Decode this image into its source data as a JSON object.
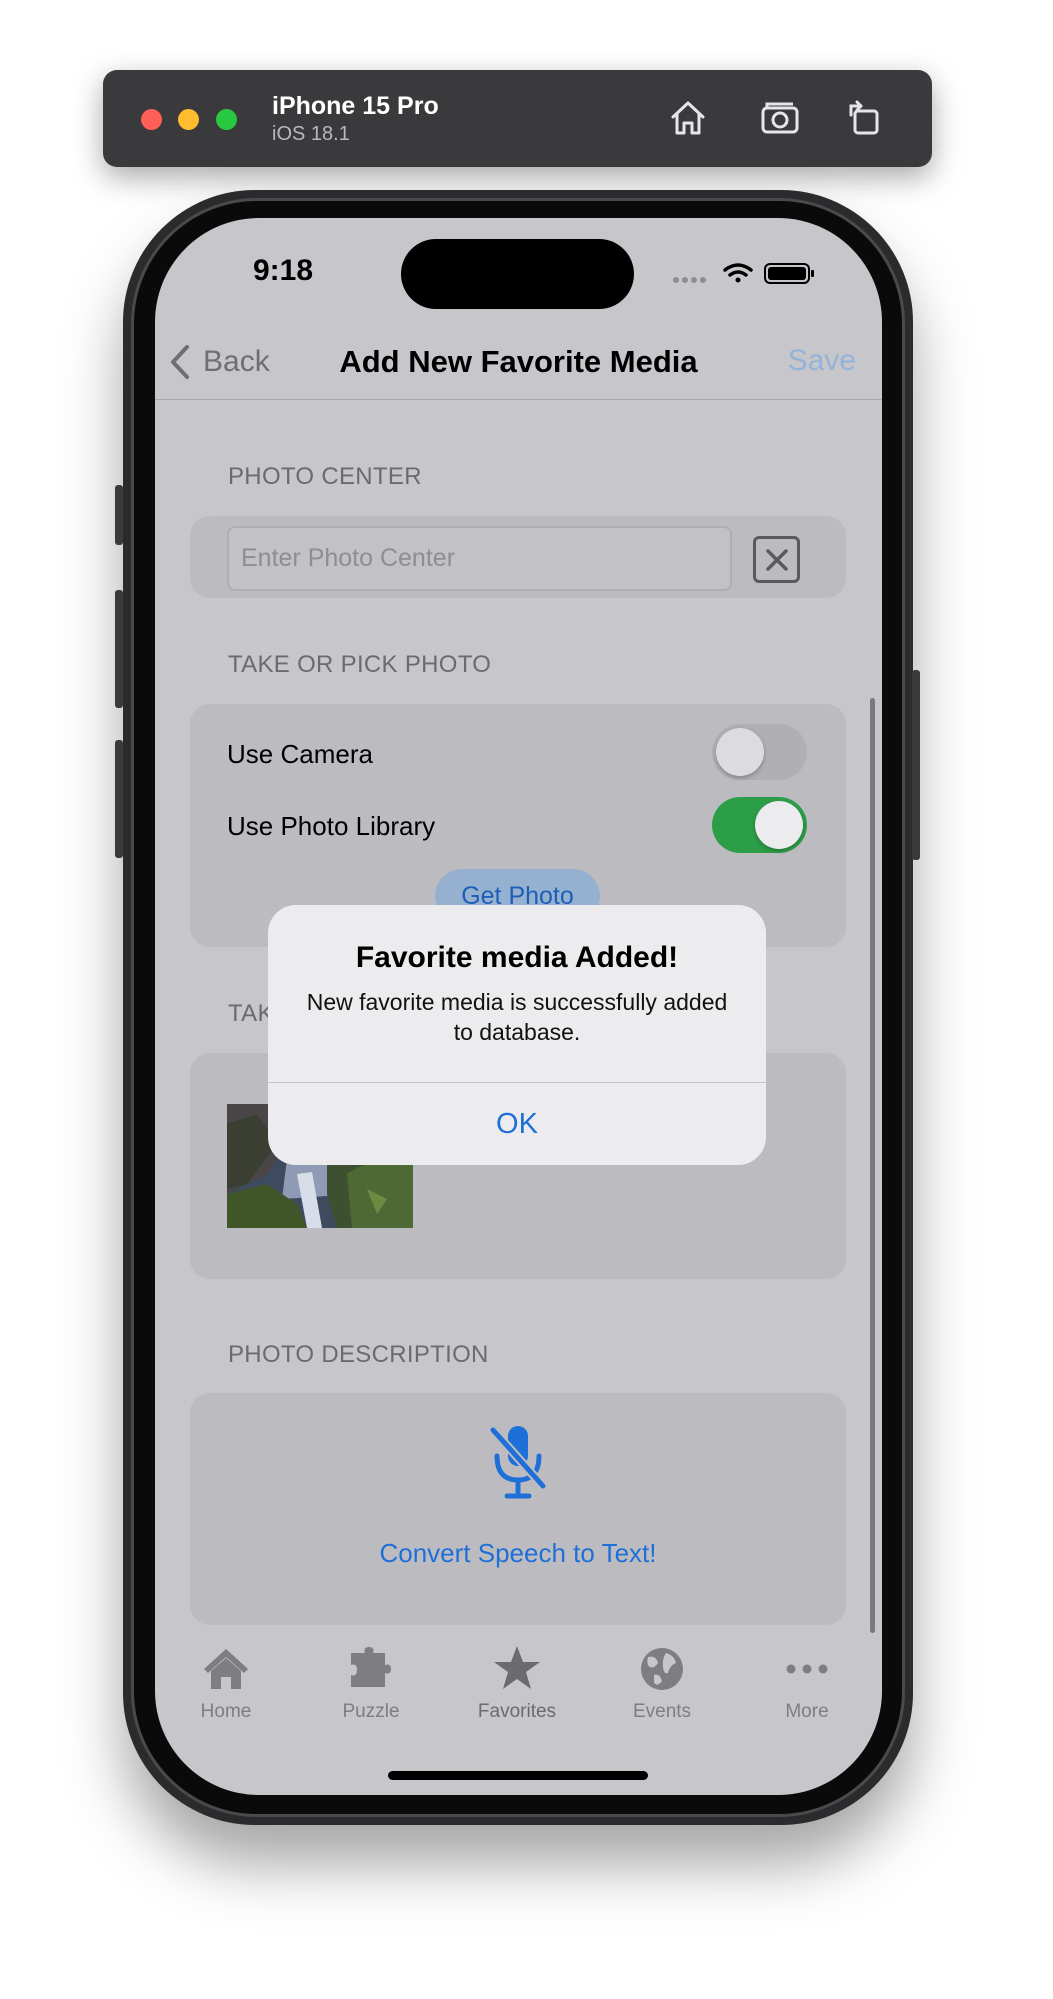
{
  "simulator": {
    "device_name": "iPhone 15 Pro",
    "os_version": "iOS 18.1",
    "icons": [
      "home-icon",
      "screenshot-icon",
      "rotate-icon"
    ]
  },
  "status_bar": {
    "time": "9:18",
    "icons": [
      "cellular-icon",
      "wifi-icon",
      "battery-icon"
    ]
  },
  "nav": {
    "back_label": "Back",
    "title": "Add New Favorite Media",
    "save_label": "Save"
  },
  "photo_center": {
    "header": "PHOTO CENTER",
    "placeholder": "Enter Photo Center",
    "value": ""
  },
  "take_pick": {
    "header": "TAKE OR PICK PHOTO",
    "use_camera_label": "Use Camera",
    "use_camera_on": false,
    "use_library_label": "Use Photo Library",
    "use_library_on": true,
    "get_photo_label": "Get Photo"
  },
  "taken_photo": {
    "header_visible": "TAK"
  },
  "description": {
    "header": "PHOTO DESCRIPTION",
    "convert_label": "Convert Speech to Text!",
    "icon": "mic-slash-icon"
  },
  "tabs": [
    {
      "label": "Home",
      "icon": "house-icon"
    },
    {
      "label": "Puzzle",
      "icon": "puzzle-icon"
    },
    {
      "label": "Favorites",
      "icon": "star-icon"
    },
    {
      "label": "Events",
      "icon": "globe-icon"
    },
    {
      "label": "More",
      "icon": "more-icon"
    }
  ],
  "alert": {
    "title": "Favorite media Added!",
    "message": "New favorite media is successfully added to database.",
    "ok_label": "OK"
  },
  "colors": {
    "accent": "#1f6fd8",
    "toggle_on": "#2d9e48",
    "traffic_red": "#fe5f57",
    "traffic_yellow": "#febc2e",
    "traffic_green": "#28c840"
  }
}
